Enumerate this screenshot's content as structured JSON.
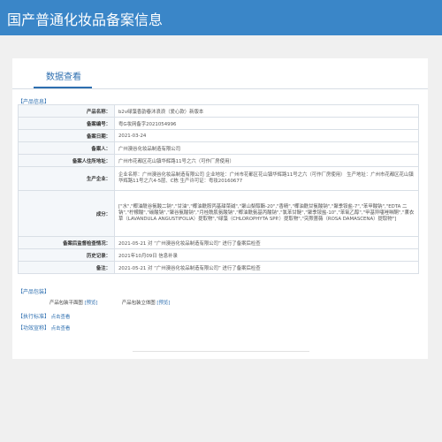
{
  "header": {
    "title": "国产普通化妆品备案信息"
  },
  "tabs": [
    {
      "label": "数据查看"
    }
  ],
  "product_info": {
    "section_title": "【产品信息】",
    "rows": [
      {
        "label": "产品名称：",
        "value": "b2v绿藻香韵春沐浪浪（爱心款）新版本"
      },
      {
        "label": "备案编号：",
        "value": "粤G妆网备字2021054996"
      },
      {
        "label": "备案日期：",
        "value": "2021-03-24"
      },
      {
        "label": "备案人：",
        "value": "广州澳谷化妆品制造有限公司"
      },
      {
        "label": "备案人住所地址：",
        "value": "广州市花都区花山镇华辉路11号之六（可作厂房使用）"
      },
      {
        "label": "生产企业：",
        "value": "企业名称：广州澳谷化妆品制造有限公司 企业地址：广州市花都区花山镇华辉路11号之六（可作厂房使用） 生产地址：广州市花都区花山镇华辉路11号之六4-5层、C栋 生产许可证：粤妆20160677"
      },
      {
        "label": "成分：",
        "value": "[\"水\",\"椰油酰谷氨酸二钠\",\"甘油\",\"椰油酰胺丙基甜菜碱\",\"聚山梨醇酯-20\",\"香精\",\"椰油酰甘氨酸钠\",\"聚季铵盐-7\",\"苯甲酸钠\",\"EDTA 二钠\",\"柠檬酸\",\"碳酸钠\",\"聚谷氨酸钠\",\"月桂酰肌氨酸钠\",\"椰油酰氨基丙酸钠\",\"氯苯甘醚\",\"聚季铵盐-10\",\"苯氧乙醇\",\"甲基异噻唑啉酮\",\"薰衣草（LAVANDULA ANGUSTIFOLIA）提取物\",\"绿藻（CHLOROPHYTA SPP.）提取物\",\"突厥蔷薇（ROSA DAMASCENA）提取物\"]"
      },
      {
        "label": "备案后监督检查情况：",
        "value": "2021-05-21 对 “广州澳谷化妆品制造有限公司” 进行了备案后检查"
      },
      {
        "label": "历史记录：",
        "value": "2021年10月09日 信息补录"
      },
      {
        "label": "备注：",
        "value": "2021-05-21 对 “广州澳谷化妆品制造有限公司” 进行了备案后检查"
      }
    ]
  },
  "packaging": {
    "section_title": "【产品包装】",
    "flat_label": "产品包装平面图",
    "flat_link": "[预览]",
    "solid_label": "产品包装立体图",
    "solid_link": "[预览]"
  },
  "standard": {
    "section_title": "【执行标准】",
    "link": "点击查看"
  },
  "claims": {
    "section_title": "【功效宣称】",
    "link": "点击查看"
  }
}
